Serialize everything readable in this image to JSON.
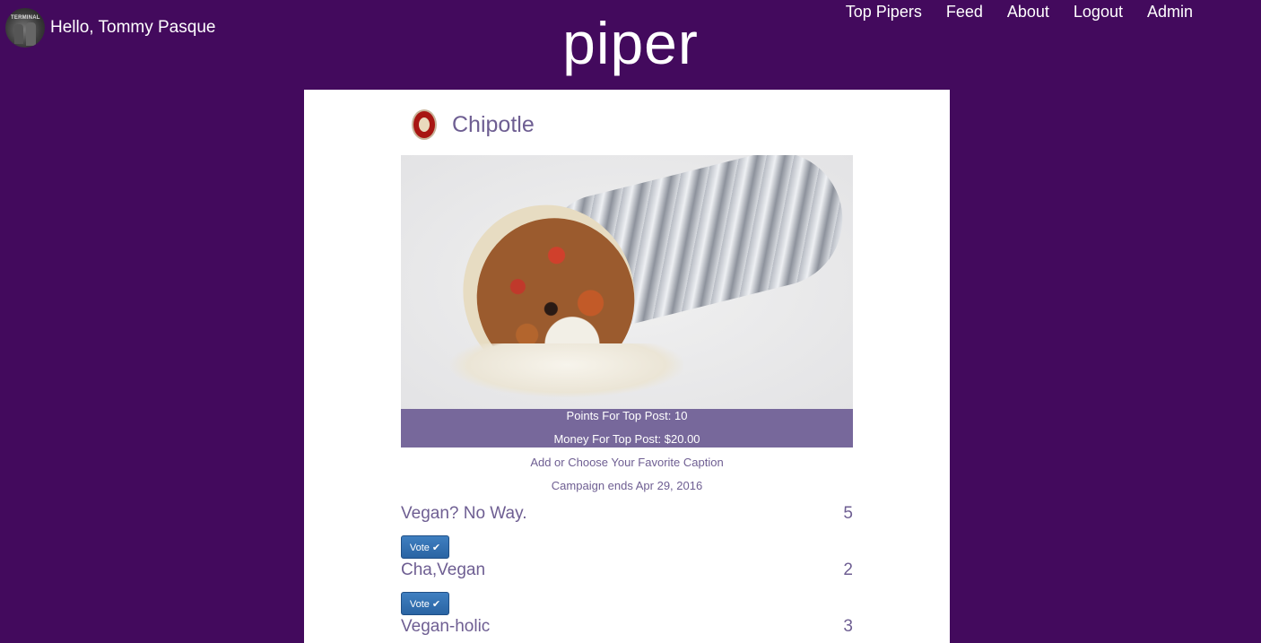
{
  "header": {
    "greeting": "Hello, Tommy Pasque",
    "avatar_sign": "TERMINAL",
    "logo": "piper",
    "nav": [
      "Top Pipers",
      "Feed",
      "About",
      "Logout",
      "Admin"
    ]
  },
  "campaign": {
    "brand_name": "Chipotle",
    "points_label": "Points For Top Post: 10",
    "money_label": "Money For Top Post: $20.00",
    "prompt": "Add or Choose Your Favorite Caption",
    "ends": "Campaign ends Apr 29, 2016"
  },
  "captions": [
    {
      "text": "Vegan? No Way.",
      "votes": "5"
    },
    {
      "text": "Cha,Vegan",
      "votes": "2"
    },
    {
      "text": "Vegan-holic",
      "votes": "3"
    }
  ],
  "vote_label": "Vote ✔",
  "colors": {
    "background": "#430a5d",
    "accent": "#6e5e92",
    "points_bar": "#77689b",
    "button": "#337ab7"
  }
}
